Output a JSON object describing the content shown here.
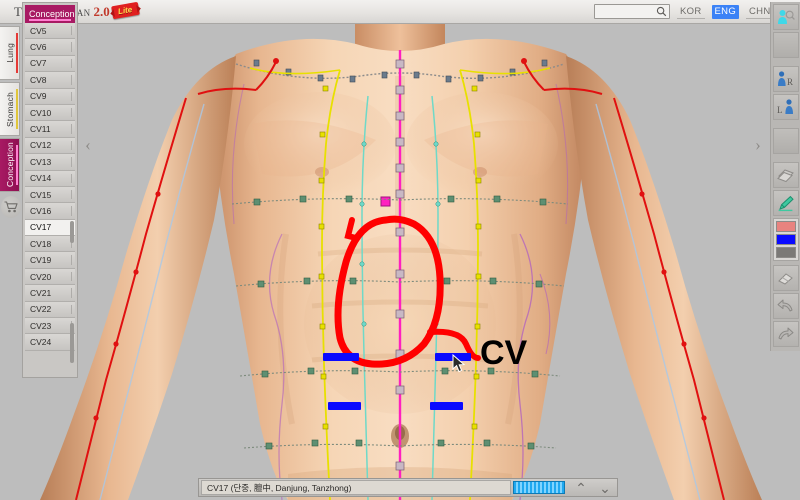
{
  "header": {
    "logo_text": "The Meridian",
    "logo_version": "2.0",
    "logo_badge": "Lite",
    "search_placeholder": "",
    "search_value": "",
    "search_icon": "search-icon",
    "languages": [
      {
        "code": "KOR",
        "active": false
      },
      {
        "code": "ENG",
        "active": true
      },
      {
        "code": "CHN",
        "active": false
      }
    ],
    "help_label": "?"
  },
  "meridian_tabs": [
    {
      "label": "Lung",
      "accent": "#e53935",
      "active": false
    },
    {
      "label": "Stomach",
      "accent": "#e0c63a",
      "active": false
    },
    {
      "label": "Conception",
      "accent": "#e040a0",
      "active": true
    }
  ],
  "cart": {
    "icon": "cart-icon",
    "label": ""
  },
  "point_panel": {
    "title": "Conception",
    "selected": "CV17",
    "items": [
      "CV5",
      "CV6",
      "CV7",
      "CV8",
      "CV9",
      "CV10",
      "CV11",
      "CV12",
      "CV13",
      "CV14",
      "CV15",
      "CV16",
      "CV17",
      "CV18",
      "CV19",
      "CV20",
      "CV21",
      "CV22",
      "CV23",
      "CV24"
    ]
  },
  "collapse": {
    "left_icon": "‹",
    "right_icon": "›"
  },
  "toolbar": {
    "items": [
      {
        "name": "person-zoom-icon",
        "label": ""
      },
      {
        "name": "spacer-1",
        "label": ""
      },
      {
        "name": "view-right-icon",
        "label": "R"
      },
      {
        "name": "view-left-icon",
        "label": "L"
      },
      {
        "name": "spacer-2",
        "label": ""
      },
      {
        "name": "layers-icon",
        "label": ""
      },
      {
        "name": "pencil-icon",
        "label": ""
      },
      {
        "name": "eraser-icon",
        "label": ""
      },
      {
        "name": "undo-icon",
        "label": ""
      },
      {
        "name": "redo-icon",
        "label": ""
      }
    ],
    "swatches": [
      {
        "name": "swatch-salmon",
        "color": "#e8837f"
      },
      {
        "name": "swatch-blue",
        "color": "#0a0aff"
      },
      {
        "name": "swatch-gray",
        "color": "#7b7976"
      }
    ]
  },
  "statusbar": {
    "point_info": "CV17 (단중, 膻中, Danjung, Tanzhong)",
    "gauge_label": "",
    "prev_icon": "⌃",
    "next_icon": "⌄"
  },
  "annotations": {
    "ellipse_color": "#ff0000",
    "text_label": "CV",
    "text_color": "#000000",
    "marks_color": "#0a0aff",
    "marks_count": 4
  },
  "anatomy": {
    "meridian_colors": {
      "conception": "#ff20c0",
      "stomach": "#e8e000",
      "lung": "#e01010",
      "kidney": "#6fd9c8",
      "spleen": "#b060c0",
      "clavicle": "#808080"
    },
    "skin_light": "#f2c9a8",
    "skin_mid": "#e3b18c",
    "skin_shadow": "#c9926d",
    "background": "#bdbdbd"
  }
}
